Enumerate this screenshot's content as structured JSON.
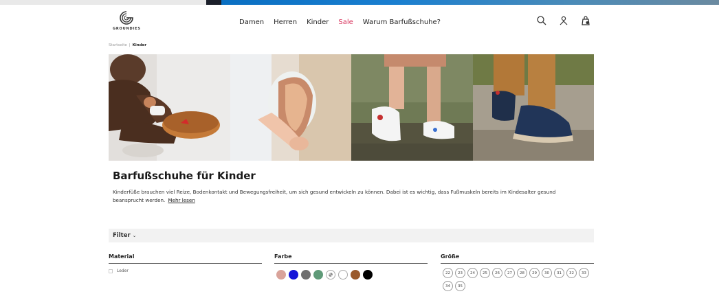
{
  "brand": {
    "logo_text": "GROUNDIES"
  },
  "nav": {
    "items": [
      {
        "label": "Damen"
      },
      {
        "label": "Herren"
      },
      {
        "label": "Kinder"
      },
      {
        "label": "Sale"
      },
      {
        "label": "Warum Barfußschuhe?"
      }
    ]
  },
  "header_icons": [
    "search-icon",
    "account-icon",
    "bag-icon"
  ],
  "breadcrumb": {
    "home": "Startseite",
    "separator": "|",
    "current": "Kinder"
  },
  "hero": {
    "images": [
      "toddler-sitting-with-shoes",
      "hand-bending-shoe",
      "child-walking-on-paving",
      "kids-boots-on-path"
    ]
  },
  "category": {
    "title": "Barfußschuhe für Kinder",
    "description": "Kinderfüße brauchen viel Reize, Bodenkontakt und Bewegungsfreiheit, um sich gesund entwickeln zu können. Dabei ist es wichtig, dass Fußmuskeln bereits im Kindesalter gesund beansprucht werden.",
    "more_link": "Mehr lesen"
  },
  "filter": {
    "label": "Filter",
    "material": {
      "heading": "Material",
      "options": [
        "Leder"
      ]
    },
    "farbe": {
      "heading": "Farbe",
      "colors": [
        "#d9a39a",
        "#1414d8",
        "#6f6f6f",
        "#5f9a78",
        "multi",
        "#ffffff",
        "#9a5a2c",
        "#000000"
      ]
    },
    "groesse": {
      "heading": "Größe",
      "sizes": [
        "22",
        "23",
        "24",
        "25",
        "26",
        "27",
        "28",
        "29",
        "30",
        "31",
        "32",
        "33",
        "34",
        "35"
      ]
    }
  },
  "colors": {
    "accent_sale": "#d8315b",
    "filterbar_bg": "#f2f2f2"
  }
}
